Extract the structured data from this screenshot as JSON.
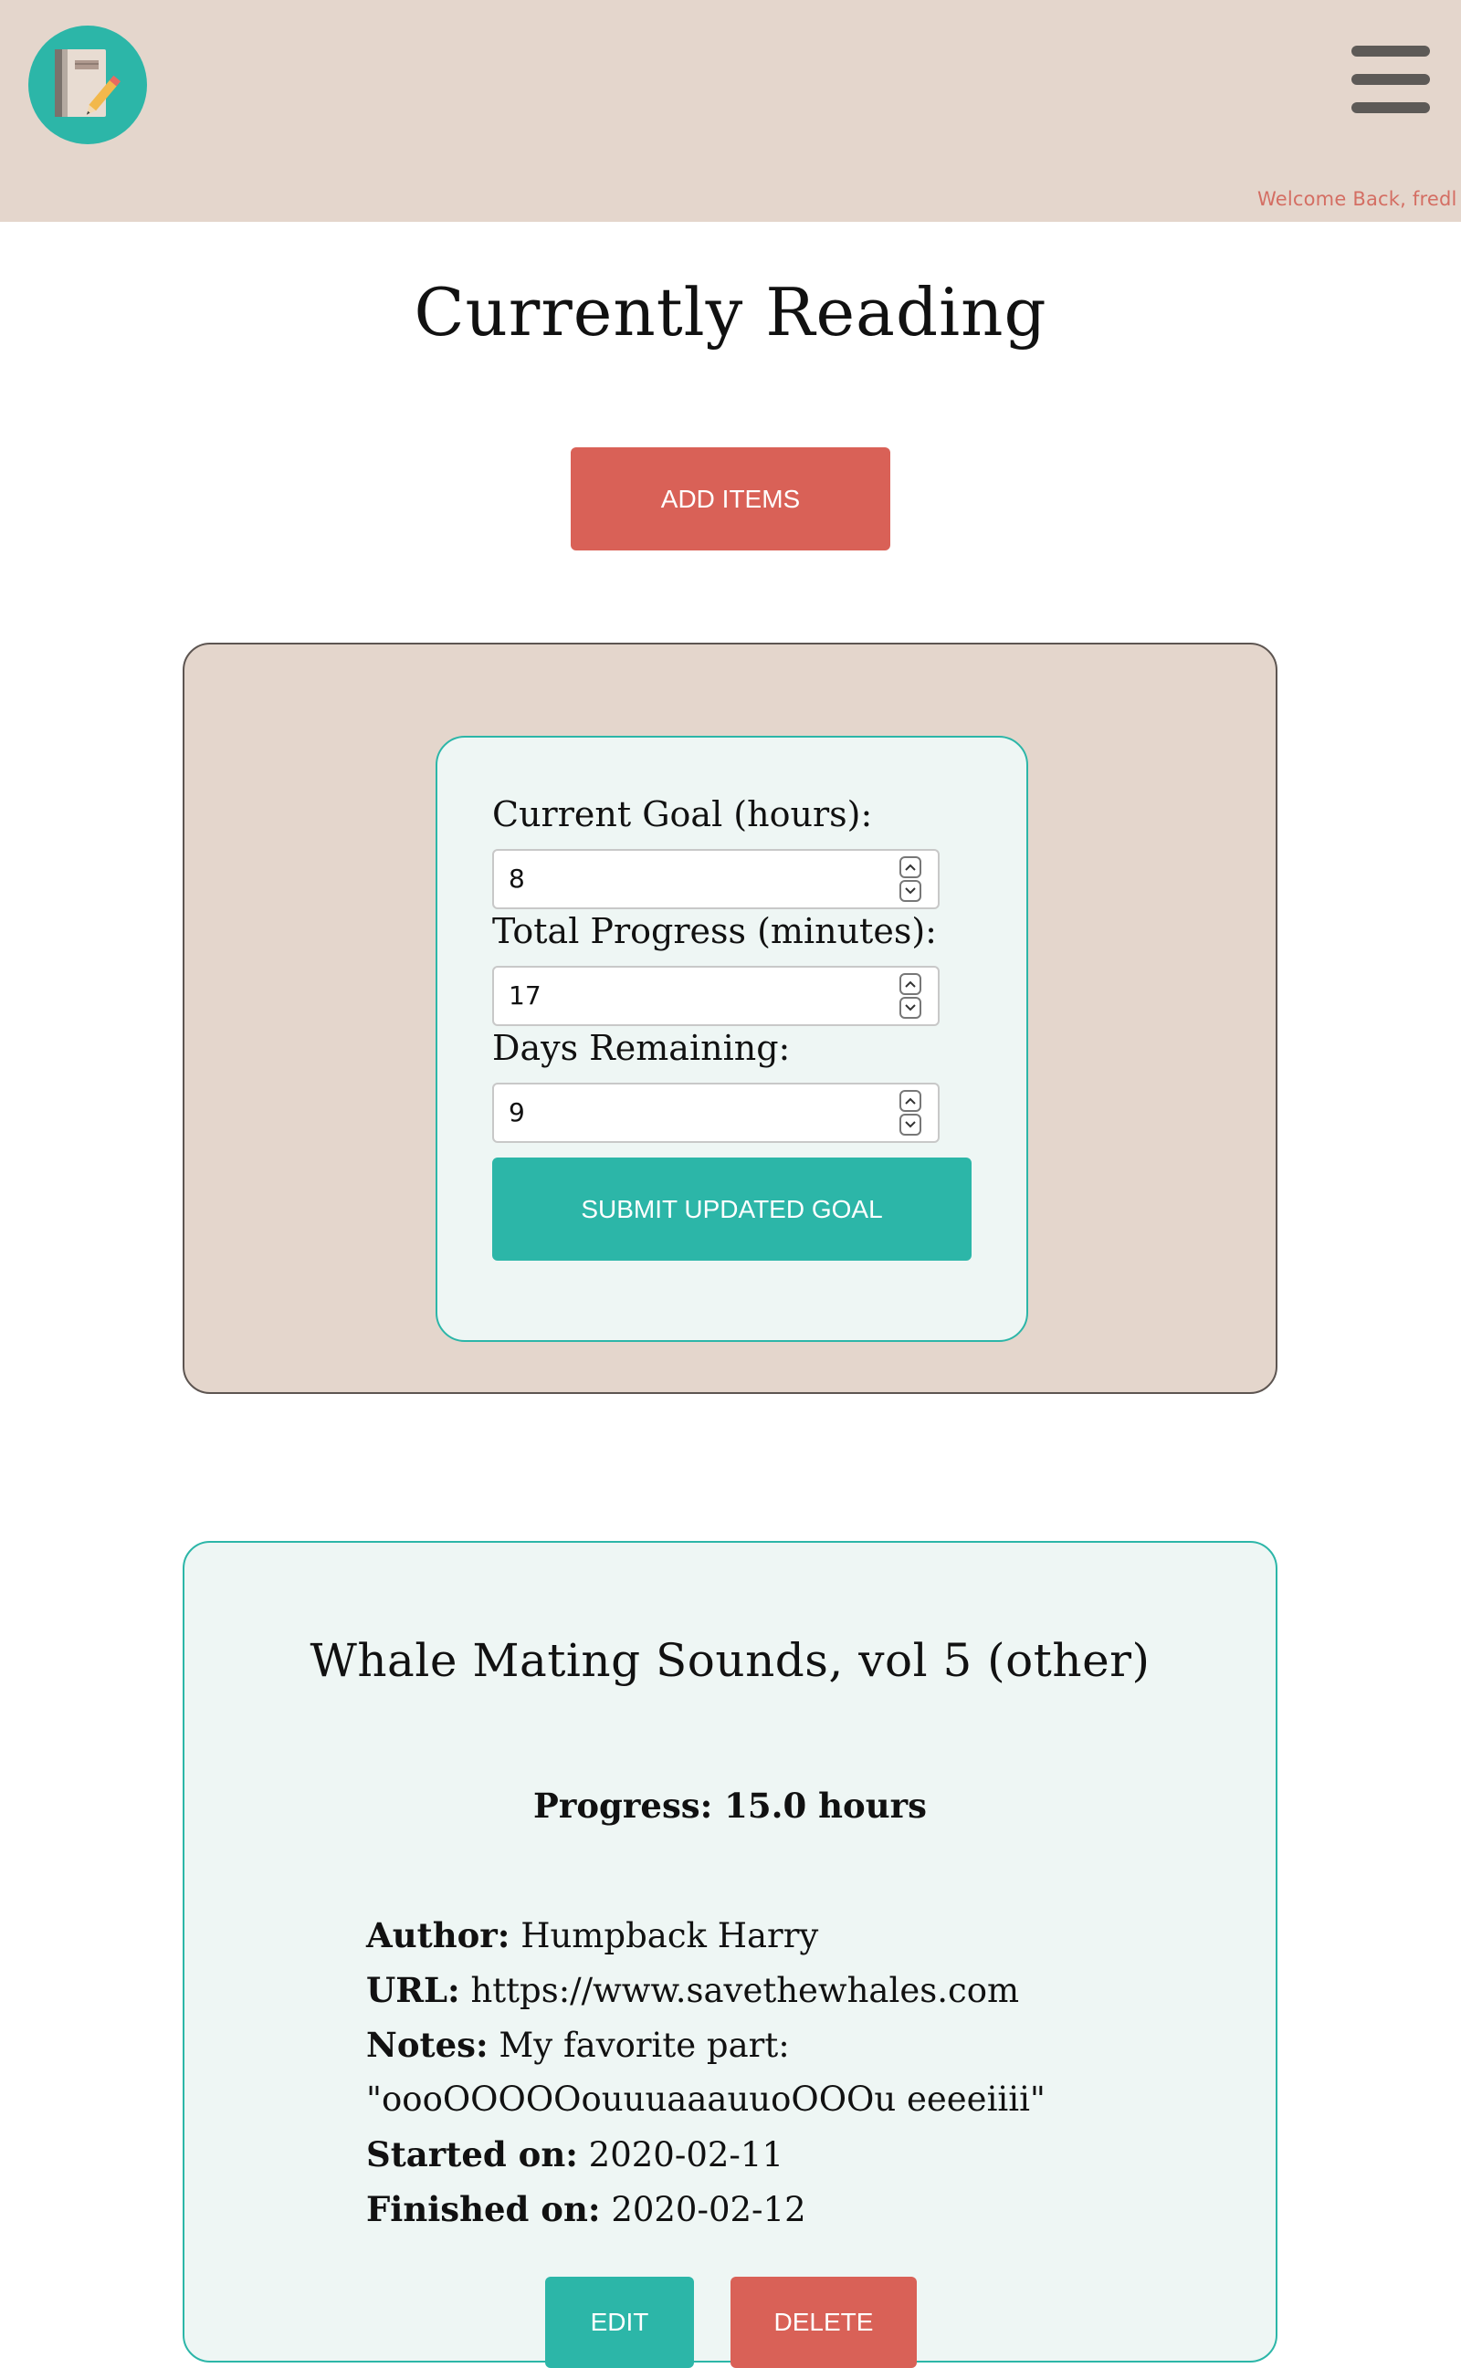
{
  "header": {
    "logo_icon": "notebook-pencil-icon",
    "menu_icon": "hamburger-menu-icon",
    "welcome_text": "Welcome Back, fredl"
  },
  "page": {
    "title": "Currently Reading",
    "add_button_label": "ADD ITEMS"
  },
  "goal_form": {
    "current_goal_label": "Current Goal (hours):",
    "current_goal_value": "8",
    "total_progress_label": "Total Progress (minutes):",
    "total_progress_value": "17",
    "days_remaining_label": "Days Remaining:",
    "days_remaining_value": "9",
    "submit_label": "SUBMIT UPDATED GOAL"
  },
  "item": {
    "title": "Whale Mating Sounds, vol 5 (other)",
    "progress_text": "Progress: 15.0 hours",
    "author_label": "Author:",
    "author_value": "Humpback Harry",
    "url_label": "URL:",
    "url_value": "https://www.savethewhales.com",
    "notes_label": "Notes:",
    "notes_line1": "My favorite part:",
    "notes_line2": "\"oooOOOOOouuuaaauuoOOOu eeeeiiii\"",
    "started_label": "Started on:",
    "started_value": "2020-02-11",
    "finished_label": "Finished on:",
    "finished_value": "2020-02-12",
    "edit_label": "EDIT",
    "delete_label": "DELETE"
  },
  "colors": {
    "header_bg": "#e4d6cc",
    "teal": "#2cb6a8",
    "coral": "#d96157",
    "card_bg": "#eef6f4",
    "menu_bars": "#5d5a57"
  }
}
